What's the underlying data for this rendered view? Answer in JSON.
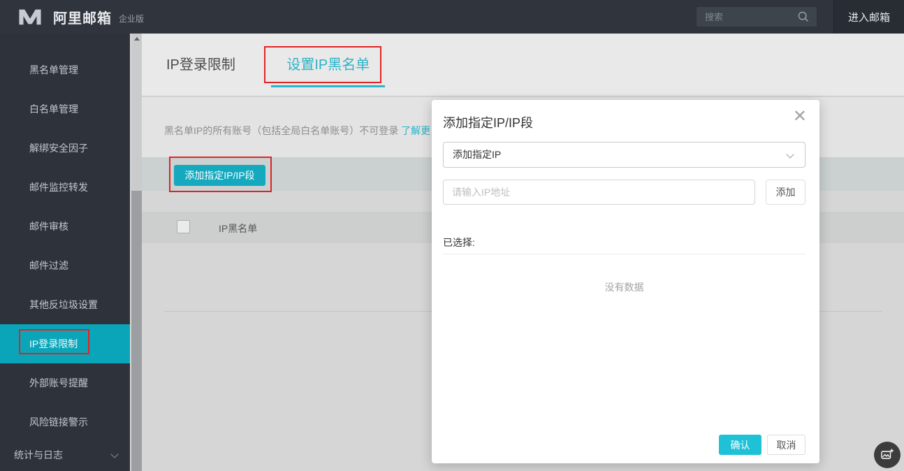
{
  "header": {
    "brand": "阿里邮箱",
    "brand_suffix": "企业版",
    "search_placeholder": "搜索",
    "enter_mailbox_label": "进入邮箱"
  },
  "sidebar": {
    "items": [
      {
        "label": "黑名单管理",
        "active": false
      },
      {
        "label": "白名单管理",
        "active": false
      },
      {
        "label": "解绑安全因子",
        "active": false
      },
      {
        "label": "邮件监控转发",
        "active": false
      },
      {
        "label": "邮件审核",
        "active": false
      },
      {
        "label": "邮件过滤",
        "active": false
      },
      {
        "label": "其他反垃圾设置",
        "active": false
      },
      {
        "label": "IP登录限制",
        "active": true,
        "annotated": true
      },
      {
        "label": "外部账号提醒",
        "active": false
      },
      {
        "label": "风险链接警示",
        "active": false
      }
    ],
    "footer": {
      "label": "统计与日志"
    }
  },
  "tabs": [
    {
      "label": "IP登录限制",
      "active": false
    },
    {
      "label": "设置IP黑名单",
      "active": true,
      "annotated": true
    }
  ],
  "content": {
    "description": "黑名单IP的所有账号（包括全局白名单账号）不可登录 ",
    "learn_more_link": "了解更",
    "add_button_label": "添加指定IP/IP段",
    "table_header": "IP黑名单"
  },
  "modal": {
    "title": "添加指定IP/IP段",
    "close_glyph": "✕",
    "select_value": "添加指定IP",
    "input_placeholder": "请输入IP地址",
    "add_button_label": "添加",
    "selected_label": "已选择:",
    "empty_text": "没有数据",
    "confirm_label": "确认",
    "cancel_label": "取消"
  },
  "colors": {
    "accent_teal": "#1fc1d7",
    "sidebar_active_teal": "#0aa5b9",
    "tab_teal": "#2cb3c5",
    "annotation_red": "#e02424",
    "header_dark": "#30353d",
    "sidebar_dark": "#2e333b"
  }
}
